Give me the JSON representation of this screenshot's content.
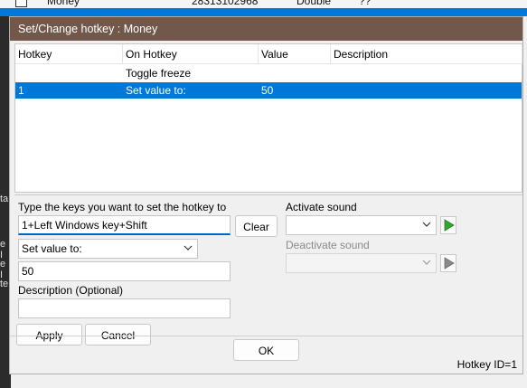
{
  "background": {
    "row_name": "Money",
    "row_address": "28313102968",
    "row_type": "Double",
    "row_value": "??",
    "left_chars": [
      "ta",
      "e I",
      "e I",
      "te"
    ]
  },
  "dialog": {
    "title": "Set/Change hotkey : Money",
    "columns": [
      "Hotkey",
      "On Hotkey",
      "Value",
      "Description"
    ],
    "rows": [
      {
        "hotkey": "",
        "on_hotkey": "Toggle freeze",
        "value": "",
        "description": "",
        "selected": false
      },
      {
        "hotkey": "1",
        "on_hotkey": "Set value to:",
        "value": "50",
        "description": "",
        "selected": true
      }
    ],
    "keys_label": "Type the keys you want to set the hotkey to",
    "keys_value": "1+Left Windows key+Shift",
    "clear_label": "Clear",
    "action_selected": "Set value to:",
    "value_input": "50",
    "description_label": "Description (Optional)",
    "description_value": "",
    "apply_label": "Apply",
    "cancel_label": "Cancel",
    "activate_sound_label": "Activate sound",
    "activate_sound_value": "",
    "deactivate_sound_label": "Deactivate sound",
    "deactivate_sound_value": "",
    "ok_label": "OK",
    "status_text": "Hotkey ID=1"
  },
  "colors": {
    "title_bar": "#72584a",
    "selection": "#0078d7",
    "play_green": "#2ea82e"
  },
  "icons": [
    "chevron-down-icon",
    "play-icon"
  ]
}
